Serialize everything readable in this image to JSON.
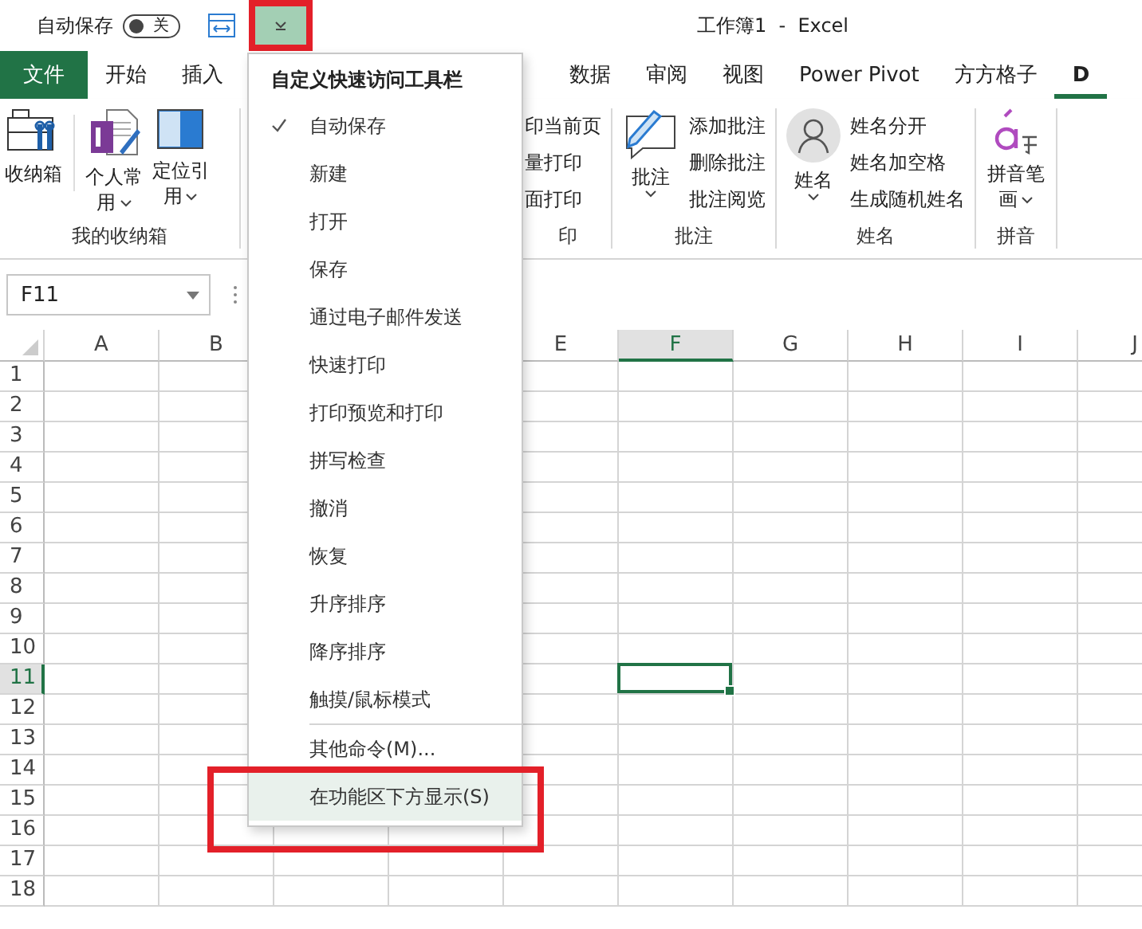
{
  "title_bar": {
    "autosave_label": "自动保存",
    "autosave_toggle": {
      "label": "关",
      "on": false
    },
    "menu_button": {
      "highlighted": true,
      "open": true
    },
    "title": "工作簿1  -  Excel"
  },
  "ribbon_tabs": [
    {
      "label": "文件",
      "kind": "file",
      "selected": false
    },
    {
      "label": "开始",
      "kind": "tab",
      "selected": false
    },
    {
      "label": "插入",
      "kind": "tab",
      "selected": false
    },
    {
      "label": "数据",
      "kind": "tab",
      "selected": false
    },
    {
      "label": "审阅",
      "kind": "tab",
      "selected": false
    },
    {
      "label": "视图",
      "kind": "tab",
      "selected": false
    },
    {
      "label": "Power Pivot",
      "kind": "tab",
      "selected": false
    },
    {
      "label": "方方格子",
      "kind": "tab",
      "selected": false
    },
    {
      "label": "D",
      "kind": "tab",
      "selected": true
    }
  ],
  "ribbon_left": {
    "buttons": [
      {
        "label": "收纳箱",
        "dropdown": false
      },
      {
        "label": "个人常用",
        "dropdown": true
      },
      {
        "label": "定位引用",
        "dropdown": true
      }
    ],
    "group_label": "我的收纳箱"
  },
  "ribbon_right": [
    {
      "kind": "list",
      "items": [
        "印当前页",
        "量打印",
        "面打印"
      ],
      "group_label": "印"
    },
    {
      "kind": "big_list",
      "button": {
        "label": "批注",
        "dropdown": true
      },
      "items": [
        "添加批注",
        "删除批注",
        "批注阅览"
      ],
      "group_label": "批注"
    },
    {
      "kind": "big_list",
      "button": {
        "label": "姓名",
        "dropdown": true
      },
      "items": [
        "姓名分开",
        "姓名加空格",
        "生成随机姓名"
      ],
      "group_label": "姓名"
    },
    {
      "kind": "big",
      "button": {
        "label": "拼音笔画",
        "dropdown": true
      },
      "group_label": "拼音"
    }
  ],
  "name_box": {
    "value": "F11"
  },
  "sheet": {
    "columns": [
      {
        "label": "A",
        "selected": false
      },
      {
        "label": "B",
        "selected": false
      },
      {
        "label": "E",
        "selected": false
      },
      {
        "label": "F",
        "selected": true
      },
      {
        "label": "G",
        "selected": false
      },
      {
        "label": "H",
        "selected": false
      },
      {
        "label": "I",
        "selected": false
      },
      {
        "label": "J",
        "selected": false
      }
    ],
    "rows": [
      {
        "label": "1",
        "selected": false
      },
      {
        "label": "2",
        "selected": false
      },
      {
        "label": "3",
        "selected": false
      },
      {
        "label": "4",
        "selected": false
      },
      {
        "label": "5",
        "selected": false
      },
      {
        "label": "6",
        "selected": false
      },
      {
        "label": "7",
        "selected": false
      },
      {
        "label": "8",
        "selected": false
      },
      {
        "label": "9",
        "selected": false
      },
      {
        "label": "10",
        "selected": false
      },
      {
        "label": "11",
        "selected": true
      },
      {
        "label": "12",
        "selected": false
      },
      {
        "label": "13",
        "selected": false
      },
      {
        "label": "14",
        "selected": false
      },
      {
        "label": "15",
        "selected": false
      },
      {
        "label": "16",
        "selected": false
      },
      {
        "label": "17",
        "selected": false
      },
      {
        "label": "18",
        "selected": false
      }
    ]
  },
  "qat_menu": {
    "title": "自定义快速访问工具栏",
    "items": [
      {
        "label": "自动保存",
        "checked": true,
        "selected": false
      },
      {
        "label": "新建",
        "checked": false,
        "selected": false
      },
      {
        "label": "打开",
        "checked": false,
        "selected": false
      },
      {
        "label": "保存",
        "checked": false,
        "selected": false
      },
      {
        "label": "通过电子邮件发送",
        "checked": false,
        "selected": false
      },
      {
        "label": "快速打印",
        "checked": false,
        "selected": false
      },
      {
        "label": "打印预览和打印",
        "checked": false,
        "selected": false
      },
      {
        "label": "拼写检查",
        "checked": false,
        "selected": false
      },
      {
        "label": "撤消",
        "checked": false,
        "selected": false
      },
      {
        "label": "恢复",
        "checked": false,
        "selected": false
      },
      {
        "label": "升序排序",
        "checked": false,
        "selected": false
      },
      {
        "label": "降序排序",
        "checked": false,
        "selected": false
      },
      {
        "label": "触摸/鼠标模式",
        "checked": false,
        "selected": false
      },
      {
        "label": "其他命令(M)...",
        "checked": false,
        "selected": false,
        "separator_before": true
      },
      {
        "label": "在功能区下方显示(S)",
        "checked": false,
        "selected": true,
        "highlighted": true
      }
    ]
  }
}
